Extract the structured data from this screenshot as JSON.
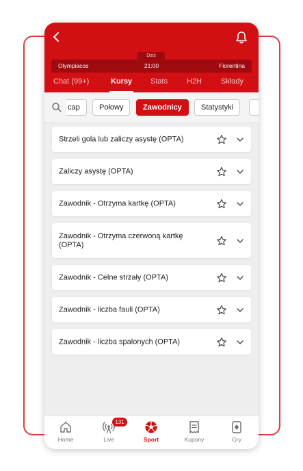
{
  "header": {
    "date_label": "Dziś",
    "home_team": "Olympiacos",
    "kickoff": "21:00",
    "away_team": "Fiorentina",
    "brand_color": "#d20f13"
  },
  "tabs": [
    {
      "label": "Chat (99+)",
      "active": false
    },
    {
      "label": "Kursy",
      "active": true
    },
    {
      "label": "Stats",
      "active": false
    },
    {
      "label": "H2H",
      "active": false
    },
    {
      "label": "Składy",
      "active": false
    }
  ],
  "filters": {
    "chips": [
      {
        "label": "cap",
        "active": false
      },
      {
        "label": "Połowy",
        "active": false
      },
      {
        "label": "Zawodnicy",
        "active": true
      },
      {
        "label": "Statystyki",
        "active": false
      },
      {
        "label": "",
        "active": false
      }
    ]
  },
  "markets": [
    {
      "label": "Strzeli gola lub zaliczy asystę (OPTA)"
    },
    {
      "label": "Zaliczy asystę (OPTA)"
    },
    {
      "label": "Zawodnik - Otrzyma kartkę (OPTA)"
    },
    {
      "label": "Zawodnik - Otrzyma czerwoną kartkę (OPTA)"
    },
    {
      "label": "Zawodnik - Celne strzały (OPTA)"
    },
    {
      "label": "Zawodnik - liczba fauli (OPTA)"
    },
    {
      "label": "Zawodnik - liczba spalonych (OPTA)"
    }
  ],
  "bottom_nav": [
    {
      "label": "Home",
      "icon": "home-icon",
      "active": false
    },
    {
      "label": "Live",
      "icon": "live-broadcast-icon",
      "active": false,
      "badge": "131"
    },
    {
      "label": "Sport",
      "icon": "football-icon",
      "active": true
    },
    {
      "label": "Kupony",
      "icon": "coupon-icon",
      "active": false
    },
    {
      "label": "Gry",
      "icon": "cards-icon",
      "active": false
    }
  ]
}
